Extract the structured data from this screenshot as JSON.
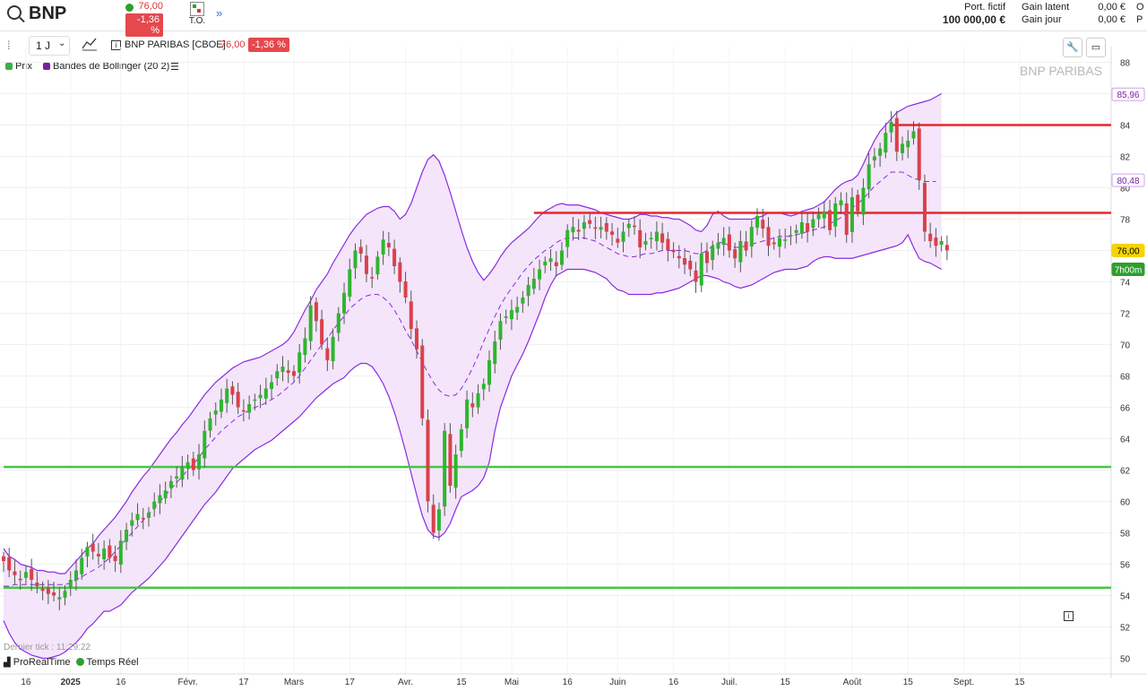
{
  "header": {
    "symbol": "BNP",
    "last_price": "76,00",
    "change_pct": "-1,36 %",
    "to_label": "T.O.",
    "expand_icon": "double-chevron-right-icon",
    "portfolio_label": "Port. fictif",
    "portfolio_value": "100 000,00 €",
    "gain_latent_label": "Gain latent",
    "gain_latent_value": "0,00 €",
    "gain_jour_label": "Gain jour",
    "gain_jour_value": "0,00 €",
    "cut_label_1": "O",
    "cut_label_2": "P"
  },
  "toolbar": {
    "timeframe": "1 J",
    "instrument": "BNP PARIBAS [CBOE]",
    "price": "76,00",
    "change_pct": "-1,36 %"
  },
  "legend": {
    "prix": "Prix",
    "bollinger": "Bandes de Bollinger (20 2)"
  },
  "chart_title": "BNP PARIBAS",
  "status": {
    "last_tick": "Dernier tick : 11:29:22",
    "provider": "ProRealTime",
    "realtime": "Temps Réel"
  },
  "colors": {
    "up": "#2fb52f",
    "down": "#d9414a",
    "band": "#8a2be2",
    "support": "#44c744",
    "resistance": "#e8262d"
  },
  "chart_data": {
    "type": "candlestick",
    "ylim": [
      49,
      89
    ],
    "y_ticks": [
      50,
      52,
      54,
      56,
      58,
      60,
      62,
      64,
      66,
      68,
      70,
      72,
      74,
      76,
      78,
      80,
      82,
      84,
      86,
      88
    ],
    "x_labels": [
      {
        "label": "16",
        "idx": 4
      },
      {
        "label": "2025",
        "idx": 12
      },
      {
        "label": "16",
        "idx": 21
      },
      {
        "label": "Févr.",
        "idx": 33
      },
      {
        "label": "17",
        "idx": 43
      },
      {
        "label": "Mars",
        "idx": 52
      },
      {
        "label": "17",
        "idx": 62
      },
      {
        "label": "Avr.",
        "idx": 72
      },
      {
        "label": "15",
        "idx": 82
      },
      {
        "label": "Mai",
        "idx": 91
      },
      {
        "label": "16",
        "idx": 101
      },
      {
        "label": "Juin",
        "idx": 110
      },
      {
        "label": "16",
        "idx": 120
      },
      {
        "label": "Juil.",
        "idx": 130
      },
      {
        "label": "15",
        "idx": 140
      },
      {
        "label": "Août",
        "idx": 152
      },
      {
        "label": "15",
        "idx": 162
      },
      {
        "label": "Sept.",
        "idx": 172
      },
      {
        "label": "15",
        "idx": 182
      }
    ],
    "close": [
      56.2,
      55.6,
      55.3,
      55.0,
      55.5,
      55.0,
      54.6,
      54.3,
      54.1,
      54.0,
      53.9,
      54.3,
      55.0,
      55.6,
      56.4,
      57.1,
      56.8,
      56.5,
      57.0,
      56.4,
      56.2,
      57.5,
      58.2,
      58.8,
      59.2,
      58.9,
      59.3,
      60.0,
      60.4,
      60.7,
      61.3,
      61.6,
      62.2,
      62.5,
      62.0,
      63.0,
      64.5,
      65.3,
      65.8,
      66.5,
      67.2,
      66.8,
      66.0,
      65.8,
      66.2,
      66.5,
      66.8,
      67.2,
      67.6,
      68.3,
      68.6,
      68.2,
      68.0,
      69.5,
      70.4,
      72.5,
      71.5,
      70.0,
      69.0,
      70.5,
      72.0,
      73.3,
      74.8,
      76.0,
      75.8,
      74.5,
      74.3,
      75.6,
      76.7,
      76.2,
      75.0,
      74.0,
      73.0,
      71.0,
      69.7,
      65.3,
      60.0,
      58.0,
      59.5,
      64.5,
      61.0,
      63.0,
      64.6,
      66.5,
      66.0,
      66.9,
      67.5,
      69.0,
      70.2,
      71.5,
      71.8,
      72.2,
      72.4,
      73.0,
      73.8,
      74.2,
      74.8,
      75.3,
      75.5,
      75.0,
      76.0,
      77.3,
      77.5,
      77.2,
      77.8,
      77.7,
      77.4,
      77.5,
      77.2,
      77.0,
      76.5,
      77.2,
      77.7,
      77.5,
      76.2,
      76.6,
      76.8,
      77.2,
      76.5,
      76.0,
      75.9,
      75.5,
      75.1,
      74.8,
      74.0,
      75.8,
      75.2,
      76.3,
      76.5,
      76.8,
      76.0,
      75.5,
      76.6,
      76.0,
      77.5,
      78.2,
      77.4,
      76.3,
      76.4,
      76.8,
      76.7,
      77.0,
      77.3,
      77.8,
      77.2,
      78.0,
      78.3,
      78.5,
      77.3,
      79.0,
      79.2,
      77.0,
      79.4,
      78.5,
      80.0,
      81.5,
      82.0,
      82.5,
      83.5,
      84.2,
      82.3,
      82.8,
      83.0,
      83.6,
      80.5,
      77.2,
      76.6,
      76.3,
      76.6,
      76.0
    ],
    "bollinger": {
      "upper": [
        57.0,
        56.5,
        56.3,
        56.0,
        55.9,
        55.8,
        55.6,
        55.6,
        55.5,
        55.5,
        55.4,
        55.4,
        55.8,
        56.2,
        56.6,
        57.0,
        57.3,
        57.8,
        58.2,
        58.6,
        59.0,
        59.5,
        60.0,
        60.6,
        61.1,
        61.6,
        62.0,
        62.5,
        63.0,
        63.5,
        64.0,
        64.4,
        64.9,
        65.3,
        65.8,
        66.3,
        66.8,
        67.2,
        67.6,
        67.9,
        68.2,
        68.5,
        68.7,
        68.9,
        69.0,
        69.1,
        69.2,
        69.4,
        69.6,
        69.8,
        70.0,
        70.3,
        70.8,
        71.5,
        72.2,
        72.8,
        73.5,
        74.0,
        74.5,
        75.2,
        75.8,
        76.4,
        77.0,
        77.5,
        77.9,
        78.3,
        78.5,
        78.7,
        78.8,
        78.8,
        78.5,
        78.0,
        78.3,
        79.0,
        80.0,
        81.0,
        81.8,
        82.1,
        81.7,
        80.8,
        79.7,
        78.5,
        77.3,
        76.2,
        75.3,
        74.6,
        74.1,
        74.5,
        75.0,
        75.6,
        76.1,
        76.5,
        76.8,
        77.1,
        77.4,
        77.8,
        78.2,
        78.5,
        78.7,
        78.9,
        79.0,
        78.9,
        78.9,
        78.9,
        78.8,
        78.7,
        78.6,
        78.4,
        78.3,
        78.2,
        78.1,
        78.0,
        78.0,
        78.1,
        78.3,
        78.3,
        78.2,
        78.2,
        78.1,
        78.1,
        78.0,
        78.0,
        77.8,
        77.6,
        77.3,
        77.2,
        77.6,
        78.3,
        78.5,
        78.2,
        78.0,
        78.0,
        78.0,
        78.0,
        78.0,
        78.1,
        78.2,
        78.4,
        78.4,
        78.4,
        78.3,
        78.2,
        78.3,
        78.5,
        78.6,
        78.7,
        78.9,
        79.1,
        79.5,
        79.9,
        80.2,
        80.4,
        80.5,
        80.8,
        81.5,
        82.3,
        83.0,
        83.6,
        84.0,
        84.4,
        84.8,
        85.0,
        85.2,
        85.3,
        85.4,
        85.5,
        85.6,
        85.8,
        86.0
      ],
      "middle": [
        54.6,
        54.6,
        54.7,
        54.7,
        54.7,
        54.7,
        54.7,
        54.7,
        54.7,
        54.7,
        54.7,
        54.7,
        54.8,
        55.0,
        55.2,
        55.4,
        55.6,
        55.8,
        56.1,
        56.4,
        56.8,
        57.2,
        57.6,
        58.0,
        58.4,
        58.8,
        59.2,
        59.6,
        60.0,
        60.4,
        60.8,
        61.2,
        61.6,
        62.0,
        62.4,
        62.8,
        63.3,
        63.7,
        64.1,
        64.5,
        64.8,
        65.1,
        65.4,
        65.6,
        65.8,
        66.0,
        66.1,
        66.3,
        66.5,
        66.7,
        67.0,
        67.3,
        67.6,
        68.0,
        68.5,
        69.0,
        69.5,
        70.0,
        70.4,
        70.9,
        71.4,
        71.8,
        72.3,
        72.6,
        72.9,
        73.1,
        73.2,
        73.2,
        73.0,
        72.7,
        72.2,
        71.6,
        70.9,
        70.3,
        69.6,
        68.9,
        68.2,
        67.6,
        67.1,
        66.8,
        66.7,
        66.8,
        67.2,
        67.8,
        68.5,
        69.3,
        70.2,
        71.0,
        71.8,
        72.5,
        73.1,
        73.6,
        74.1,
        74.6,
        75.0,
        75.4,
        75.7,
        76.0,
        76.2,
        76.5,
        76.7,
        76.8,
        76.8,
        76.8,
        76.8,
        76.7,
        76.6,
        76.4,
        76.2,
        76.0,
        75.8,
        75.7,
        75.6,
        75.6,
        75.7,
        75.8,
        75.8,
        75.9,
        76.0,
        76.0,
        76.0,
        76.0,
        76.0,
        75.9,
        75.8,
        75.8,
        76.0,
        76.3,
        76.5,
        76.5,
        76.3,
        76.2,
        76.2,
        76.3,
        76.4,
        76.5,
        76.6,
        76.7,
        76.8,
        76.9,
        76.9,
        76.9,
        77.0,
        77.1,
        77.2,
        77.3,
        77.4,
        77.5,
        77.7,
        77.9,
        78.1,
        78.4,
        78.7,
        79.0,
        79.3,
        79.7,
        80.1,
        80.4,
        80.7,
        81.0,
        81.0,
        81.0,
        80.8,
        80.6,
        80.5,
        80.4,
        80.4,
        80.4
      ],
      "lower": [
        52.4,
        51.6,
        51.0,
        50.6,
        50.4,
        50.2,
        50.1,
        50.0,
        50.0,
        50.1,
        50.2,
        50.4,
        50.7,
        51.0,
        51.4,
        51.9,
        52.2,
        52.6,
        53.0,
        53.0,
        53.2,
        53.4,
        53.8,
        54.2,
        54.5,
        54.8,
        55.1,
        55.5,
        55.9,
        56.3,
        56.8,
        57.3,
        57.8,
        58.3,
        58.8,
        59.3,
        59.8,
        60.2,
        60.6,
        61.1,
        61.6,
        62.1,
        62.4,
        62.7,
        63.0,
        63.3,
        63.5,
        63.7,
        63.9,
        64.2,
        64.5,
        64.8,
        65.1,
        65.4,
        65.8,
        66.2,
        66.6,
        66.9,
        67.2,
        67.5,
        67.7,
        67.9,
        68.3,
        68.6,
        68.8,
        68.8,
        68.6,
        68.1,
        67.5,
        66.7,
        65.7,
        64.5,
        63.2,
        61.8,
        60.4,
        59.1,
        58.2,
        57.8,
        57.7,
        58.0,
        58.6,
        59.5,
        60.3,
        60.5,
        60.7,
        61.0,
        61.5,
        62.5,
        64.5,
        66.0,
        67.0,
        68.0,
        68.7,
        69.4,
        70.2,
        71.1,
        72.0,
        73.0,
        73.8,
        74.4,
        74.6,
        74.8,
        74.8,
        74.8,
        74.8,
        74.7,
        74.6,
        74.4,
        74.2,
        73.8,
        73.5,
        73.4,
        73.2,
        73.2,
        73.2,
        73.2,
        73.2,
        73.3,
        73.3,
        73.4,
        73.5,
        73.6,
        73.8,
        74.0,
        74.2,
        74.4,
        74.4,
        74.3,
        74.2,
        74.0,
        73.9,
        73.7,
        73.6,
        73.7,
        73.8,
        74.0,
        74.2,
        74.4,
        74.6,
        74.7,
        74.8,
        74.8,
        74.8,
        74.9,
        75.0,
        75.3,
        75.5,
        75.6,
        75.6,
        75.5,
        75.5,
        75.5,
        75.5,
        75.6,
        75.7,
        75.8,
        75.9,
        76.0,
        76.1,
        76.2,
        76.3,
        76.5,
        77.0,
        76.2,
        75.5,
        75.3,
        75.2,
        75.0,
        74.8
      ]
    },
    "horizontal_lines": [
      {
        "value": 62.2,
        "color": "#44c744",
        "from_idx": 0
      },
      {
        "value": 54.5,
        "color": "#44c744",
        "from_idx": 0
      },
      {
        "value": 78.4,
        "color": "#e8262d",
        "from_idx": 95
      },
      {
        "value": 84.0,
        "color": "#e8262d",
        "from_idx": 159
      }
    ],
    "price_labels": [
      {
        "value": 85.96,
        "text": "85,96",
        "style": "band"
      },
      {
        "value": 80.48,
        "text": "80,48",
        "style": "band"
      },
      {
        "value": 76.0,
        "text": "76,00",
        "style": "last"
      },
      {
        "value": 74.8,
        "text": "7h00m",
        "style": "timer"
      }
    ]
  }
}
